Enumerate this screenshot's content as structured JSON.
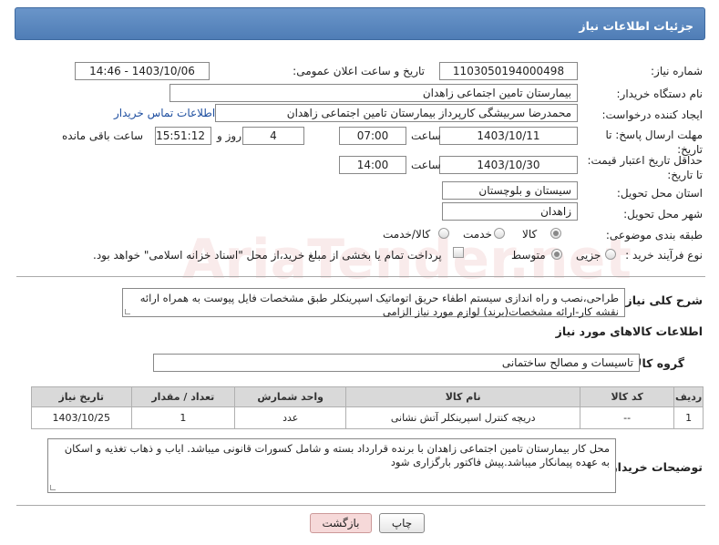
{
  "page": {
    "title": "جزئیات اطلاعات نیاز"
  },
  "form": {
    "need_number_label": "شماره نیاز:",
    "need_number": "1103050194000498",
    "announce_label": "تاریخ و ساعت اعلان عمومی:",
    "announce_value": "1403/10/06 - 14:46",
    "buyer_org_label": "نام دستگاه خریدار:",
    "buyer_org": "بیمارستان تامین اجتماعی زاهدان",
    "creator_label": "ایجاد کننده درخواست:",
    "creator": "محمدرضا سربیشگی کارپرداز بیمارستان تامین اجتماعی زاهدان",
    "contact_link": "اطلاعات تماس خریدار",
    "deadline_label": "مهلت ارسال پاسخ: تا تاریخ:",
    "deadline_date": "1403/10/11",
    "time_label": "ساعت",
    "deadline_time": "07:00",
    "days_value": "4",
    "days_label": "روز و",
    "remaining_time": "15:51:12",
    "remaining_label": "ساعت باقی مانده",
    "validity_label": "حداقل تاریخ اعتبار قیمت: تا تاریخ:",
    "validity_date": "1403/10/30",
    "validity_time": "14:00",
    "province_label": "استان محل تحویل:",
    "province": "سیستان و بلوچستان",
    "city_label": "شهر محل تحویل:",
    "city": "زاهدان",
    "category_label": "طبقه بندی موضوعی:",
    "category_options": [
      "کالا",
      "خدمت",
      "کالا/خدمت"
    ],
    "process_label": "نوع فرآیند خرید :",
    "process_options": [
      "جزیی",
      "متوسط"
    ],
    "payment_note": "پرداخت تمام یا بخشی از مبلغ خرید،از محل \"اسناد خزانه اسلامی\" خواهد بود."
  },
  "description": {
    "label": "شرح کلی نیاز:",
    "text": "طراحی،نصب و راه اندازی سیستم اطفاء حریق اتوماتیک اسپرینکلر طبق مشخصات فایل پیوست به همراه ارائه نقشه کار-ارائه مشخصات(برند) لوازم مورد نیاز الزامی"
  },
  "goods": {
    "section_title": "اطلاعات کالاهای مورد نیاز",
    "group_label": "گروه کالا:",
    "group_value": "تاسیسات و مصالح ساختمانی",
    "columns": [
      "ردیف",
      "کد کالا",
      "نام کالا",
      "واحد شمارش",
      "تعداد / مقدار",
      "تاریخ نیاز"
    ],
    "rows": [
      [
        "1",
        "--",
        "دریچه کنترل اسپرینکلر آتش نشانی",
        "عدد",
        "1",
        "1403/10/25"
      ]
    ]
  },
  "buyer_notes": {
    "label": "توضیحات خریدار:",
    "text": "محل کار بیمارستان تامین اجتماعی زاهدان  با برنده قرارداد بسته و شامل کسورات قانونی میباشد. ایاب و ذهاب  تغذیه و اسکان به عهده پیمانکار میباشد.پیش فاکتور بارگزاری شود"
  },
  "buttons": {
    "print": "چاپ",
    "back": "بازگشت"
  },
  "watermark": "AriaTender.net",
  "colors": {
    "header": "#5a87c0",
    "back_button": "#f6d9d9"
  }
}
